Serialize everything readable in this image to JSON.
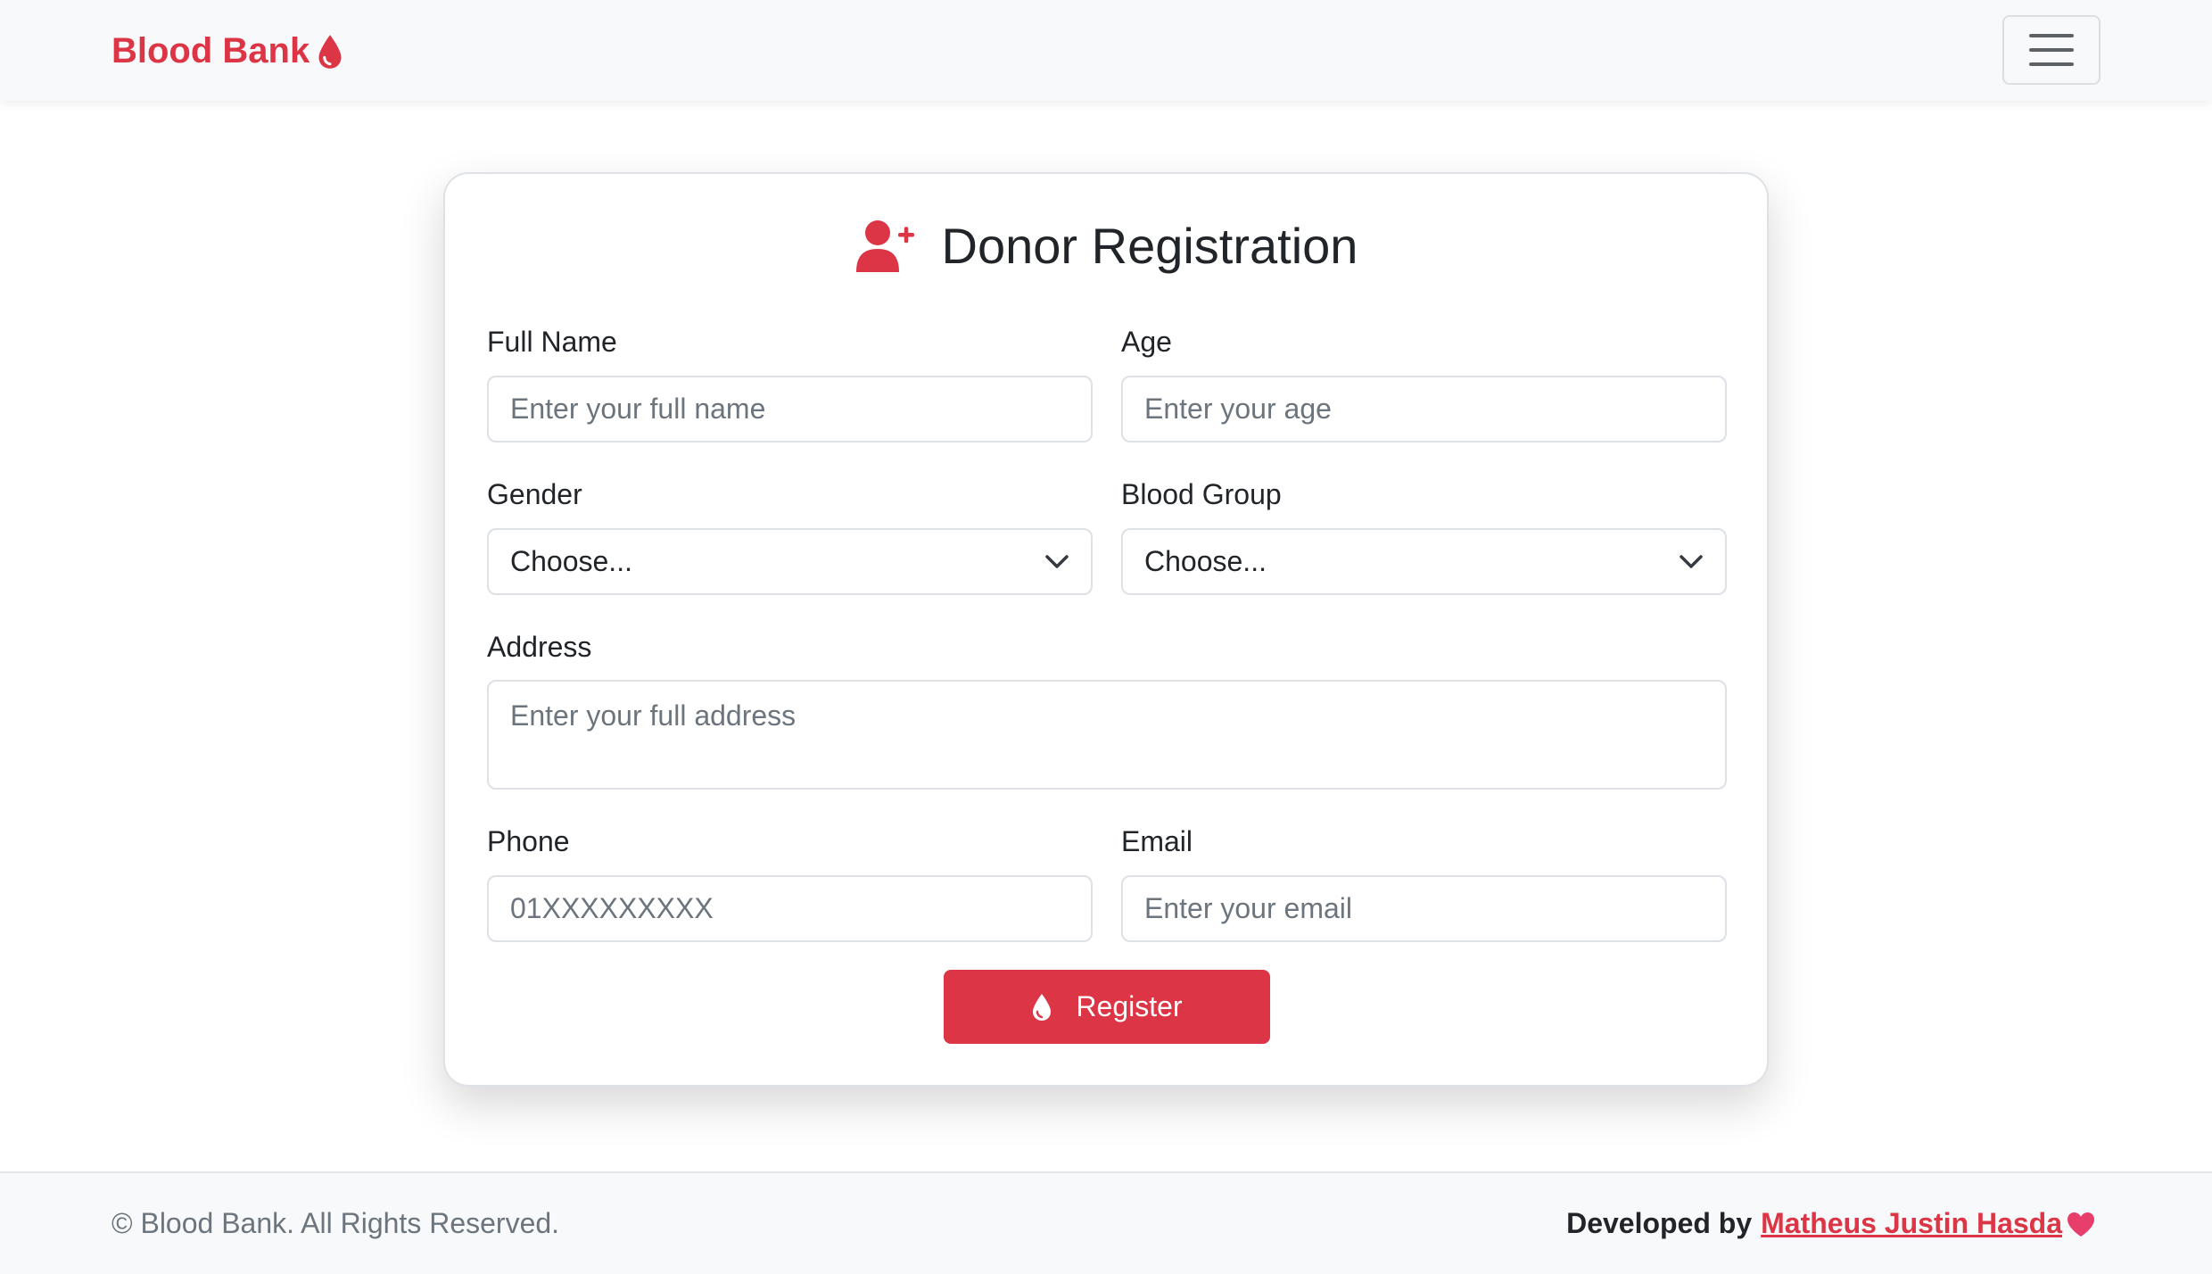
{
  "colors": {
    "accent": "#dc3545",
    "navbar_bg": "#f8f9fa",
    "heart": "#e83e6c",
    "text": "#212529",
    "muted": "#6c757d"
  },
  "navbar": {
    "brand": "Blood Bank",
    "brand_icon": "droplet-icon",
    "toggler_icon": "hamburger-menu-icon"
  },
  "form": {
    "title": "Donor Registration",
    "title_icon": "user-plus-icon",
    "fields": {
      "full_name": {
        "label": "Full Name",
        "placeholder": "Enter your full name",
        "value": ""
      },
      "age": {
        "label": "Age",
        "placeholder": "Enter your age",
        "value": ""
      },
      "gender": {
        "label": "Gender",
        "selected": "Choose..."
      },
      "blood_group": {
        "label": "Blood Group",
        "selected": "Choose..."
      },
      "address": {
        "label": "Address",
        "placeholder": "Enter your full address",
        "value": ""
      },
      "phone": {
        "label": "Phone",
        "placeholder": "01XXXXXXXXX",
        "value": ""
      },
      "email": {
        "label": "Email",
        "placeholder": "Enter your email",
        "value": ""
      }
    },
    "submit": {
      "label": "Register",
      "icon": "droplet-icon"
    }
  },
  "footer": {
    "copyright": "© Blood Bank. All Rights Reserved.",
    "developed_by": "Developed by",
    "author": "Matheus Justin Hasda",
    "heart_icon": "heart-icon"
  }
}
